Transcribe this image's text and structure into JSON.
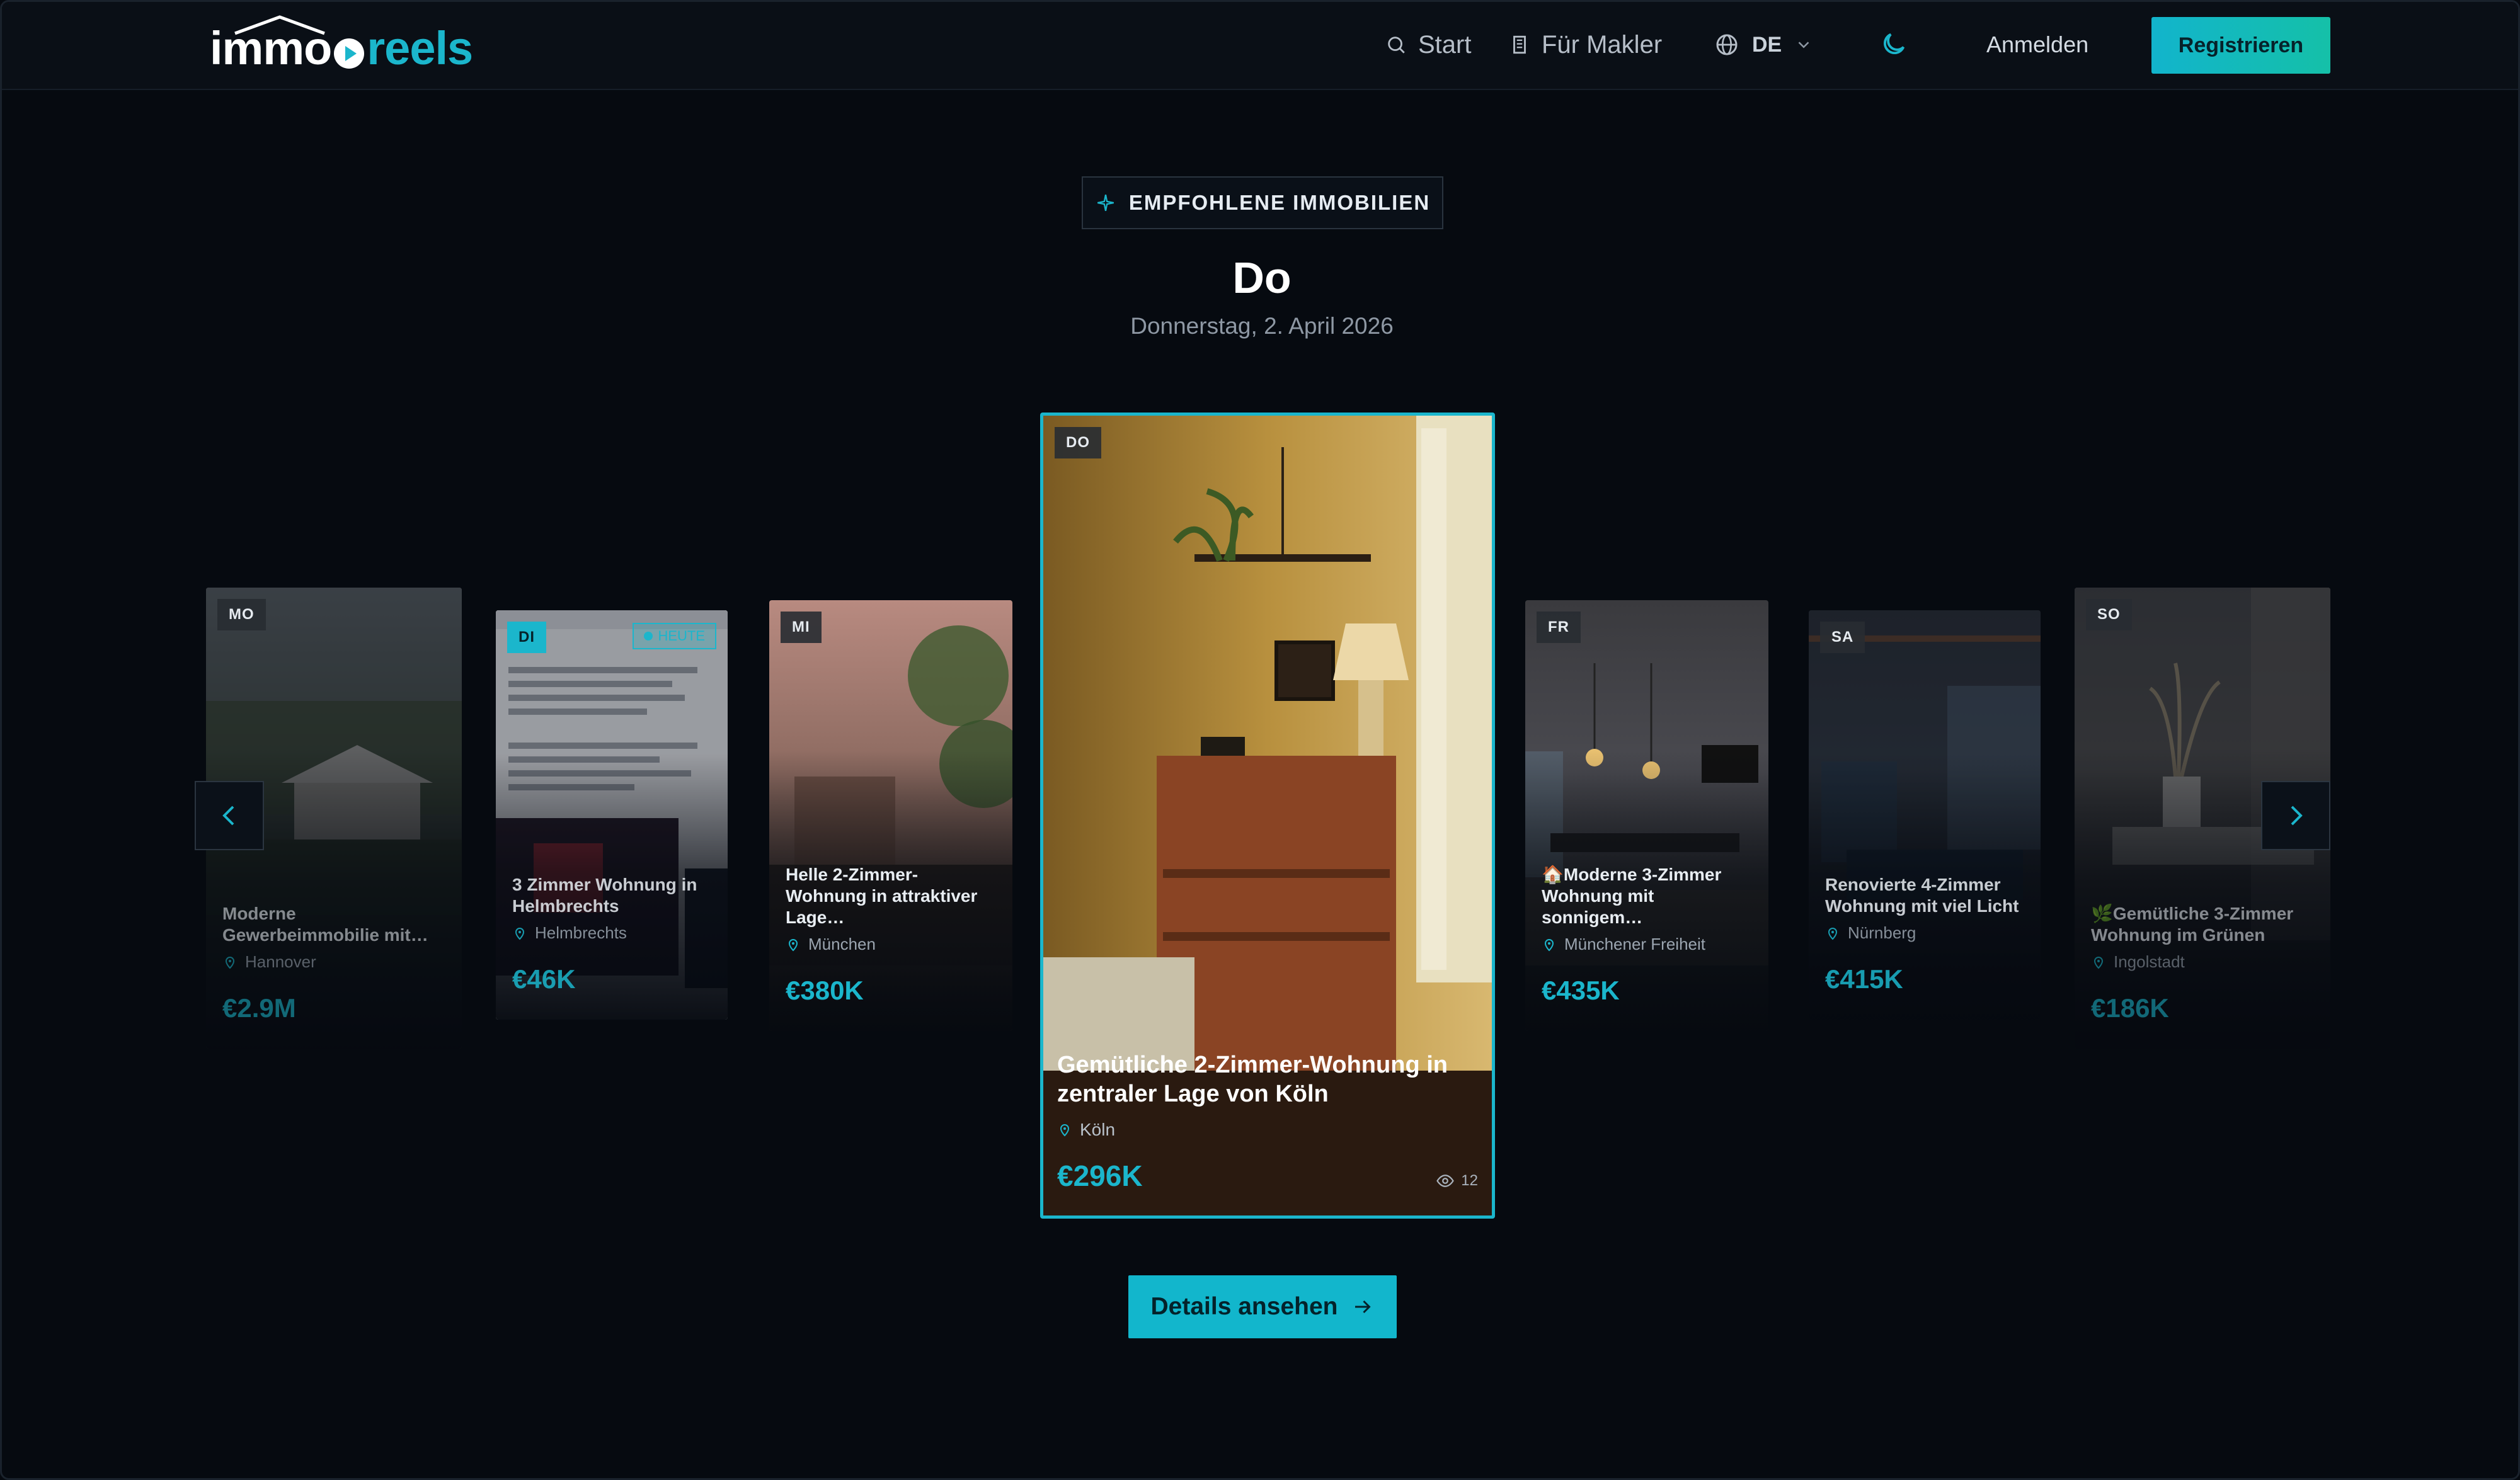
{
  "nav": {
    "logo_part1": "immo",
    "logo_part2": "reels",
    "links": [
      {
        "label": "Start",
        "icon": "search-icon"
      },
      {
        "label": "Für Makler",
        "icon": "building-icon"
      }
    ],
    "language": "DE",
    "login_label": "Anmelden",
    "register_label": "Registrieren"
  },
  "header": {
    "badge": "EMPFOHLENE IMMOBILIEN",
    "day": "Do",
    "date": "Donnerstag, 2. April 2026"
  },
  "cards": [
    {
      "day": "MO",
      "title": "Moderne Gewerbeimmobilie mit…",
      "location": "Hannover",
      "price": "€2.9M"
    },
    {
      "day": "DI",
      "today": "HEUTE",
      "title": "3 Zimmer Wohnung in Helmbrechts",
      "location": "Helmbrechts",
      "price": "€46K"
    },
    {
      "day": "MI",
      "title": "Helle 2-Zimmer-Wohnung in attraktiver Lage…",
      "location": "München",
      "price": "€380K"
    },
    {
      "day": "DO",
      "title": "Gemütliche 2-Zimmer-Wohnung in zentraler Lage von Köln",
      "location": "Köln",
      "price": "€296K",
      "views": "12"
    },
    {
      "day": "FR",
      "title": "🏠Moderne 3-Zimmer Wohnung mit sonnigem…",
      "location": "Münchener Freiheit",
      "price": "€435K"
    },
    {
      "day": "SA",
      "title": "Renovierte 4-Zimmer Wohnung mit viel Licht",
      "location": "Nürnberg",
      "price": "€415K"
    },
    {
      "day": "SO",
      "title": "🌿Gemütliche 3-Zimmer Wohnung im Grünen",
      "location": "Ingolstadt",
      "price": "€186K"
    }
  ],
  "details_label": "Details ansehen",
  "colors": {
    "accent": "#1bb6cc",
    "background": "#060a10"
  }
}
